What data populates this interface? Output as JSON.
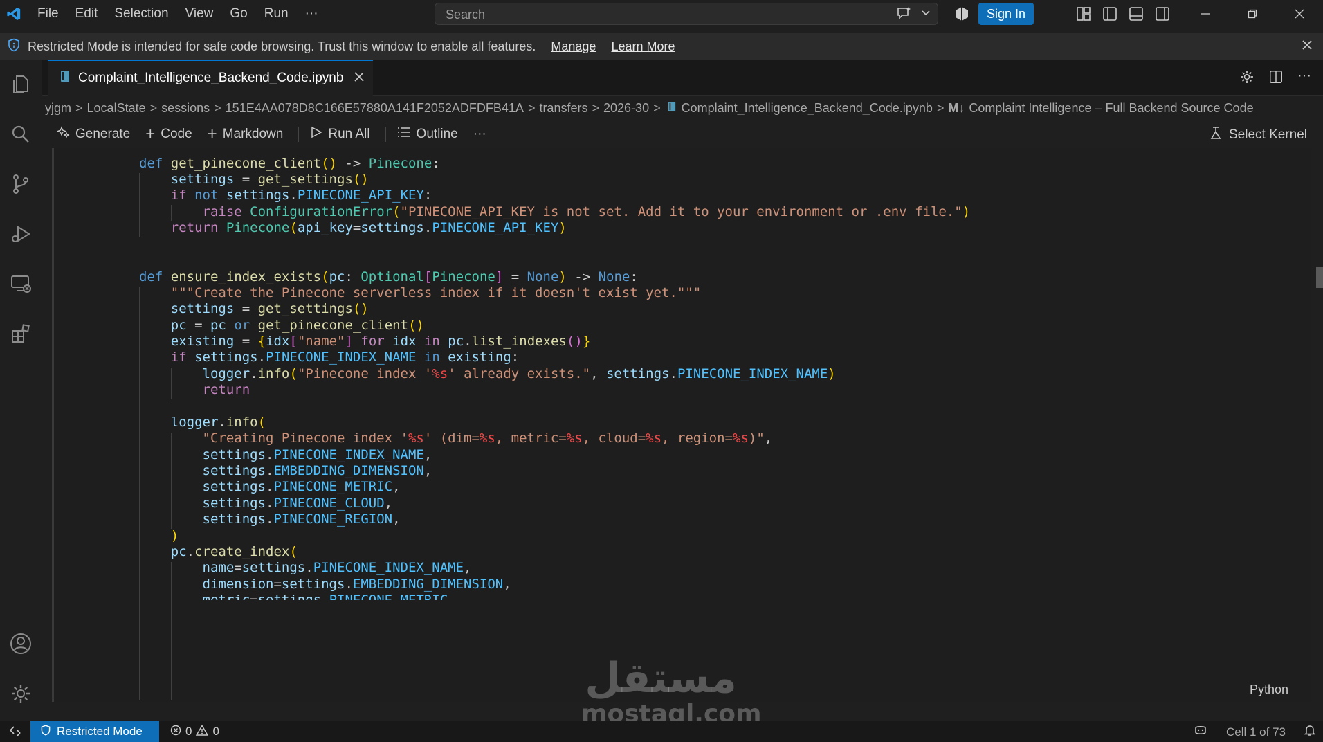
{
  "titlebar": {
    "menu": [
      "File",
      "Edit",
      "Selection",
      "View",
      "Go",
      "Run",
      "···"
    ],
    "search_placeholder": "Search",
    "sign_in": "Sign In"
  },
  "banner": {
    "message": "Restricted Mode is intended for safe code browsing. Trust this window to enable all features.",
    "manage": "Manage",
    "learn_more": "Learn More"
  },
  "tab": {
    "title": "Complaint_Intelligence_Backend_Code.ipynb"
  },
  "breadcrumb": [
    "yjgm",
    "LocalState",
    "sessions",
    "151E4AA078D8C166E57880A141F2052ADFDFB41A",
    "transfers",
    "2026-30",
    "Complaint_Intelligence_Backend_Code.ipynb",
    "Complaint Intelligence – Full Backend Source Code"
  ],
  "toolbar": {
    "generate": "Generate",
    "code": "Code",
    "markdown": "Markdown",
    "run_all": "Run All",
    "outline": "Outline",
    "more": "···",
    "kernel": "Select Kernel"
  },
  "cell": {
    "language": "Python"
  },
  "status": {
    "restricted": "Restricted Mode",
    "errors": "0",
    "warnings": "0",
    "cell_pos": "Cell 1 of 73"
  },
  "watermark": {
    "arabic": "مستقل",
    "latin": "mostaql.com"
  },
  "colors": {
    "accent": "#0078d4",
    "signin": "#0e6fb8",
    "background": "#1f1f1f"
  }
}
